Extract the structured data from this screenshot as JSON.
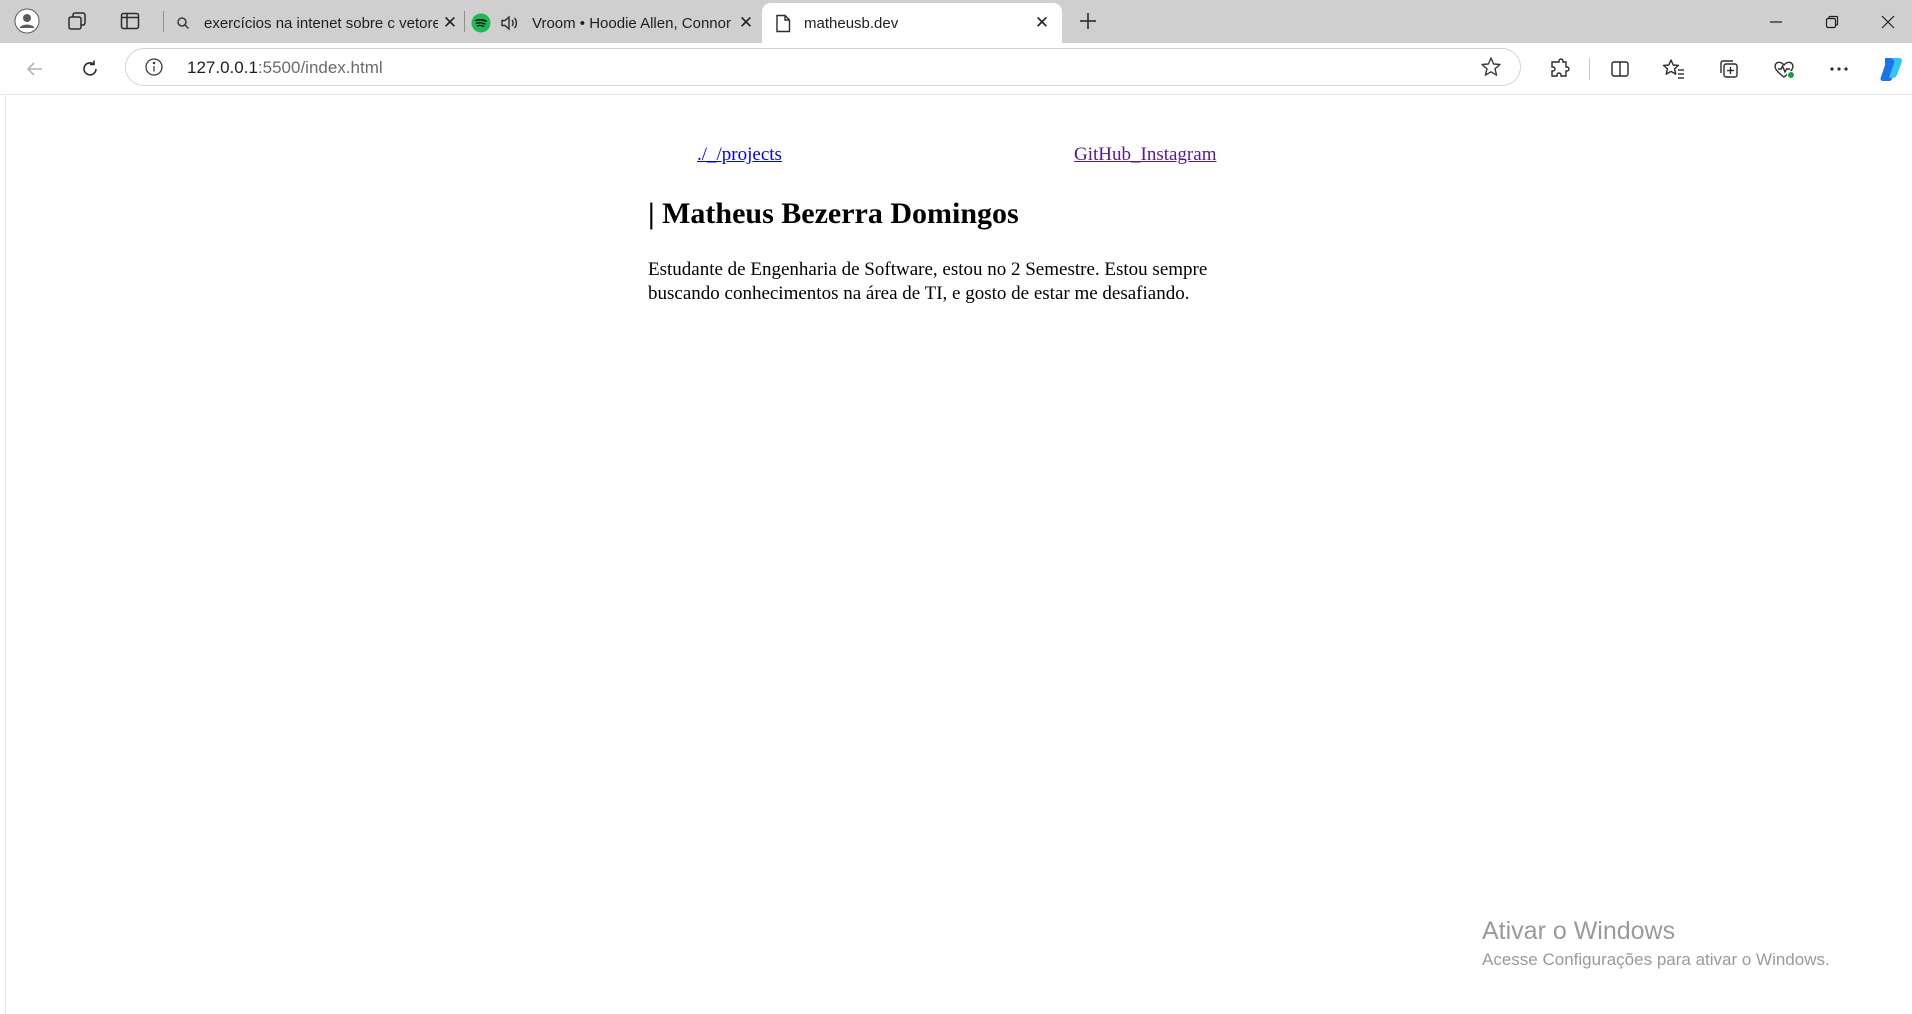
{
  "browser": {
    "tabs": [
      {
        "title": "exercícios na intenet sobre c vetores",
        "icon": "search-icon",
        "active": false
      },
      {
        "title": "Vroom • Hoodie Allen, Connor",
        "icon": "spotify-icon",
        "audio": "speaker-icon",
        "active": false
      },
      {
        "title": "matheusb.dev",
        "icon": "page-icon",
        "active": true
      }
    ],
    "address": {
      "host": "127.0.0.1",
      "rest": ":5500/index.html"
    },
    "colors": {
      "tabstrip": "#cfcfcf",
      "toolbar": "#ffffff",
      "spotify": "#1db954",
      "copilot": "#1a73e8"
    }
  },
  "page": {
    "nav": {
      "left_link": "./_/projects",
      "right_link": "GitHub_Instagram"
    },
    "title": "| Matheus Bezerra Domingos",
    "description": "Estudante de Engenharia de Software, estou no 2 Semestre. Estou sempre buscando conhecimentos na área de TI, e gosto de estar me desafiando."
  },
  "watermark": {
    "title": "Ativar o Windows",
    "subtitle": "Acesse Configurações para ativar o Windows."
  }
}
